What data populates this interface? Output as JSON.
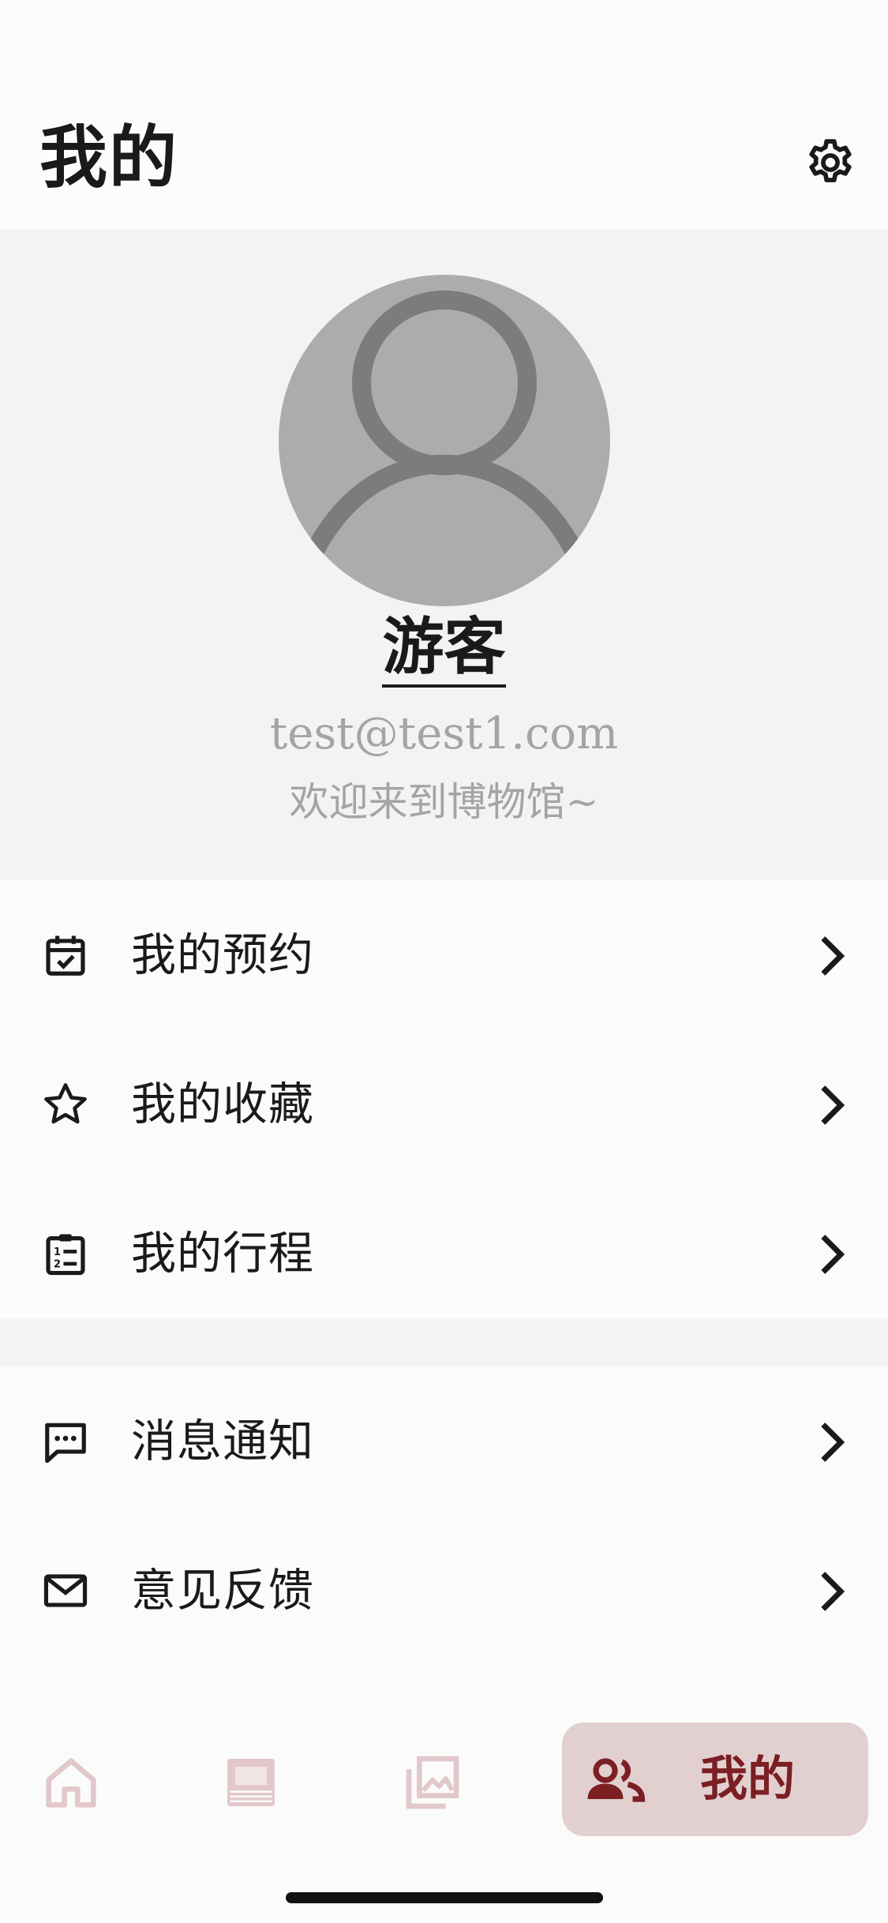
{
  "header": {
    "title": "我的"
  },
  "profile": {
    "username": "游客",
    "email": "test@test1.com",
    "welcome": "欢迎来到博物馆~"
  },
  "menu_group_1": [
    {
      "label": "我的预约",
      "icon": "calendar-check-icon"
    },
    {
      "label": "我的收藏",
      "icon": "star-icon"
    },
    {
      "label": "我的行程",
      "icon": "clipboard-list-icon"
    }
  ],
  "menu_group_2": [
    {
      "label": "消息通知",
      "icon": "message-icon"
    },
    {
      "label": "意见反馈",
      "icon": "mail-icon"
    }
  ],
  "tabbar": {
    "tabs": [
      {
        "icon": "home-icon"
      },
      {
        "icon": "exhibition-icon"
      },
      {
        "icon": "gallery-icon"
      },
      {
        "icon": "people-icon",
        "label": "我的",
        "active": true
      }
    ]
  },
  "colors": {
    "accent": "#7b1f23",
    "accent_bg": "#e2d0d0",
    "inactive_tab": "#e2c8cb",
    "secondary_text": "#a4a4a4"
  }
}
